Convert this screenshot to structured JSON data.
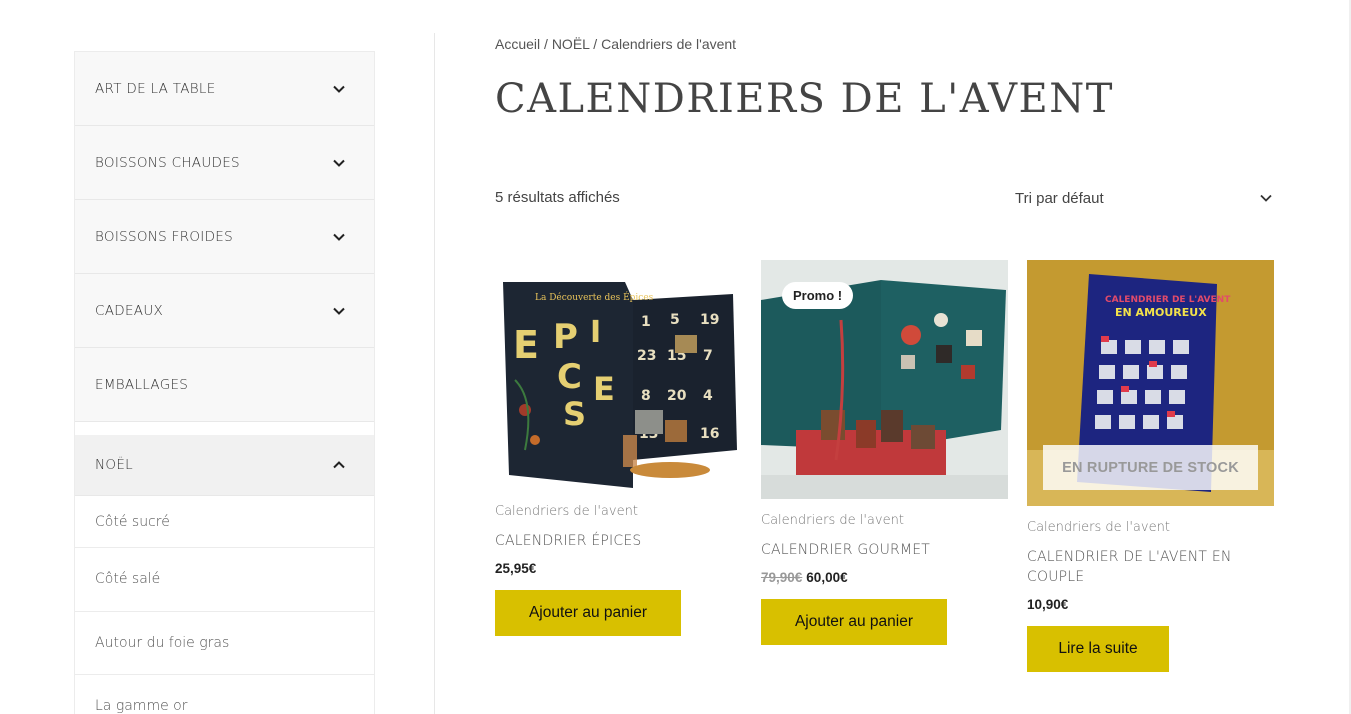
{
  "sidebar": {
    "categories": [
      {
        "label": "ART DE LA TABLE",
        "icon": "chevron-down-icon"
      },
      {
        "label": "BOISSONS CHAUDES",
        "icon": "chevron-down-icon"
      },
      {
        "label": "BOISSONS FROIDES",
        "icon": "chevron-down-icon"
      },
      {
        "label": "CADEAUX",
        "icon": "chevron-down-icon"
      },
      {
        "label": "EMBALLAGES"
      },
      {
        "label": "NOËL",
        "icon": "chevron-up-icon"
      }
    ],
    "subcategories": [
      "Côté sucré",
      "Côté salé",
      "Autour du foie gras",
      "La gamme or"
    ]
  },
  "breadcrumb": {
    "home": "Accueil",
    "sep": " / ",
    "parent": "NOËL",
    "current": "Calendriers de l'avent"
  },
  "page_title": "CALENDRIERS DE L'AVENT",
  "results_count": "5 résultats affichés",
  "sort": {
    "label": "Tri par défaut",
    "icon": "chevron-down-icon"
  },
  "products": [
    {
      "category": "Calendriers de l'avent",
      "name": "CALENDRIER ÉPICES",
      "price": "25,95€",
      "button": "Ajouter au panier",
      "numbers": [
        "1",
        "5",
        "19",
        "23",
        "15",
        "7",
        "8",
        "20",
        "4",
        "13",
        "2",
        "16"
      ],
      "image_text": "La Découverte des Épices"
    },
    {
      "category": "Calendriers de l'avent",
      "name": "CALENDRIER GOURMET",
      "old_price": "79,90€",
      "price": "60,00€",
      "badge": "Promo !",
      "button": "Ajouter au panier"
    },
    {
      "category": "Calendriers de l'avent",
      "name": "CALENDRIER DE L'AVENT EN COUPLE",
      "price": "10,90€",
      "overlay": "EN RUPTURE DE STOCK",
      "button": "Lire la suite",
      "image_title_1": "CALENDRIER DE L'AVENT",
      "image_title_2": "EN AMOUREUX"
    }
  ],
  "colors": {
    "accent": "#d8c000",
    "sidebar_bg": "#f8f8f8",
    "text": "#333333"
  }
}
